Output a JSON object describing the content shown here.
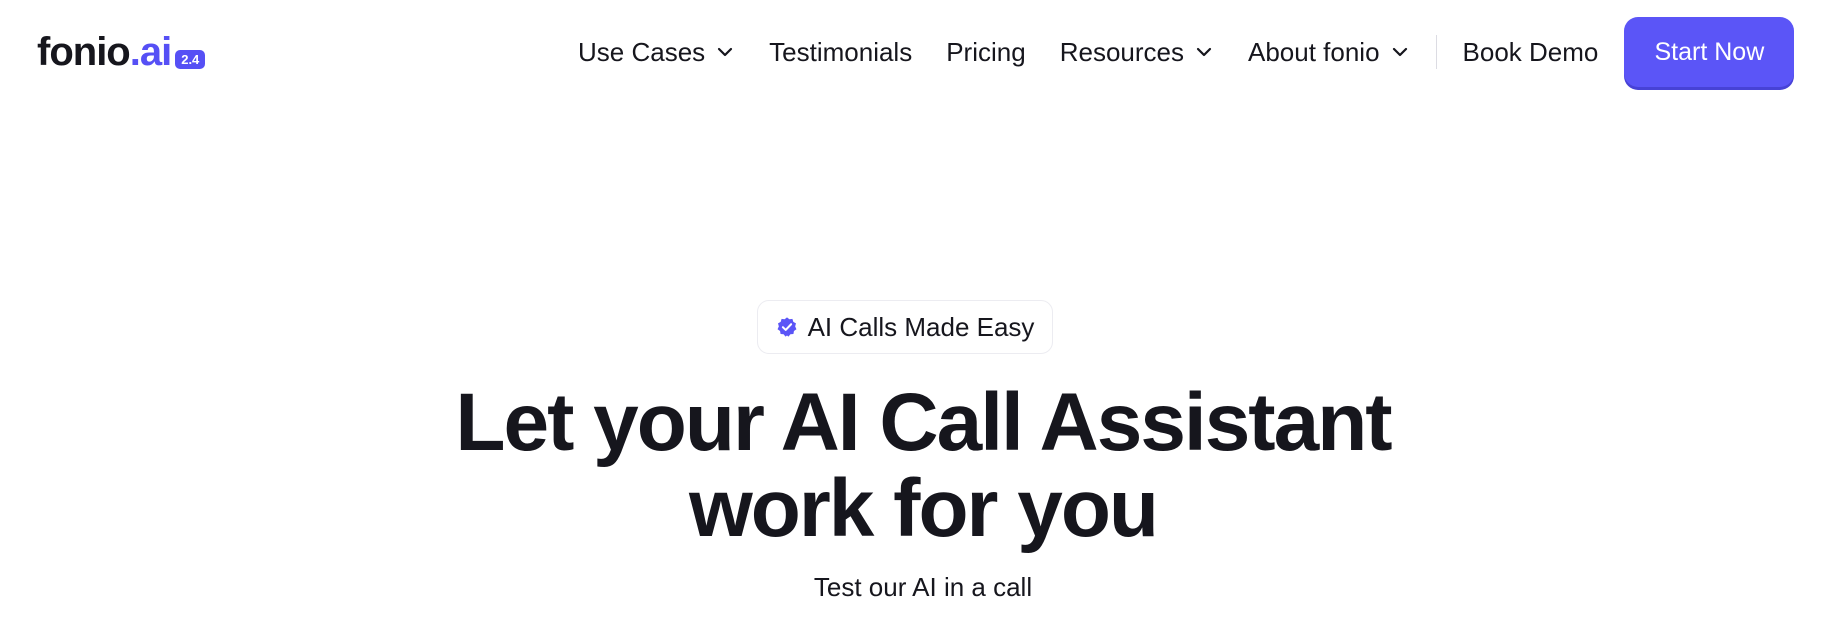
{
  "logo": {
    "brand": "fonio",
    "suffix": ".ai",
    "version": "2.4"
  },
  "nav": {
    "items": [
      {
        "label": "Use Cases",
        "has_dropdown": true
      },
      {
        "label": "Testimonials",
        "has_dropdown": false
      },
      {
        "label": "Pricing",
        "has_dropdown": false
      },
      {
        "label": "Resources",
        "has_dropdown": true
      },
      {
        "label": "About fonio",
        "has_dropdown": true
      }
    ],
    "book_demo": "Book Demo",
    "start_now": "Start Now"
  },
  "hero": {
    "badge": "AI Calls Made Easy",
    "title_line1": "Let your AI Call Assistant",
    "title_line2": "work for you",
    "subtitle": "Test our AI in a call"
  },
  "colors": {
    "accent": "#5b55f7",
    "text": "#16161d"
  }
}
